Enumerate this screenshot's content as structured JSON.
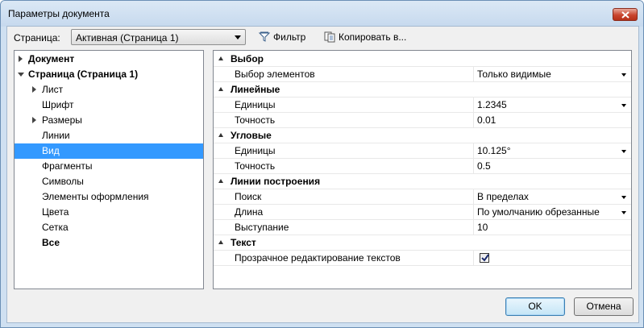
{
  "window": {
    "title": "Параметры документа"
  },
  "toolbar": {
    "page_label": "Страница:",
    "page_select_value": "Активная (Страница 1)",
    "filter_label": "Фильтр",
    "copy_label": "Копировать в..."
  },
  "tree": {
    "items": [
      {
        "label": "Документ"
      },
      {
        "label": "Страница (Страница 1)"
      },
      {
        "label": "Лист"
      },
      {
        "label": "Шрифт"
      },
      {
        "label": "Размеры"
      },
      {
        "label": "Линии"
      },
      {
        "label": "Вид"
      },
      {
        "label": "Фрагменты"
      },
      {
        "label": "Символы"
      },
      {
        "label": "Элементы оформления"
      },
      {
        "label": "Цвета"
      },
      {
        "label": "Сетка"
      },
      {
        "label": "Все"
      }
    ]
  },
  "props": {
    "cat_selection": "Выбор",
    "selection_elements_name": "Выбор элементов",
    "selection_elements_value": "Только видимые",
    "cat_linear": "Линейные",
    "linear_units_name": "Единицы",
    "linear_units_value": "1.2345",
    "linear_precision_name": "Точность",
    "linear_precision_value": "0.01",
    "cat_angular": "Угловые",
    "angular_units_name": "Единицы",
    "angular_units_value": "10.125°",
    "angular_precision_name": "Точность",
    "angular_precision_value": "0.5",
    "cat_construction": "Линии построения",
    "search_name": "Поиск",
    "search_value": "В пределах",
    "length_name": "Длина",
    "length_value": "По умолчанию обрезанные",
    "overhang_name": "Выступание",
    "overhang_value": "10",
    "cat_text": "Текст",
    "transparent_edit_name": "Прозрачное редактирование текстов",
    "transparent_edit_checked": true
  },
  "buttons": {
    "ok": "OK",
    "cancel": "Отмена"
  },
  "icons": {
    "close": "close-icon",
    "filter": "filter-icon",
    "copy": "copy-icon",
    "expand": "expand-arrow-icon",
    "collapse": "collapse-arrow-icon",
    "dropdown": "chevron-down-icon",
    "check": "check-icon"
  },
  "colors": {
    "selection": "#3399ff",
    "title_bar": "#c6d9ee",
    "close_button": "#c9452e"
  }
}
